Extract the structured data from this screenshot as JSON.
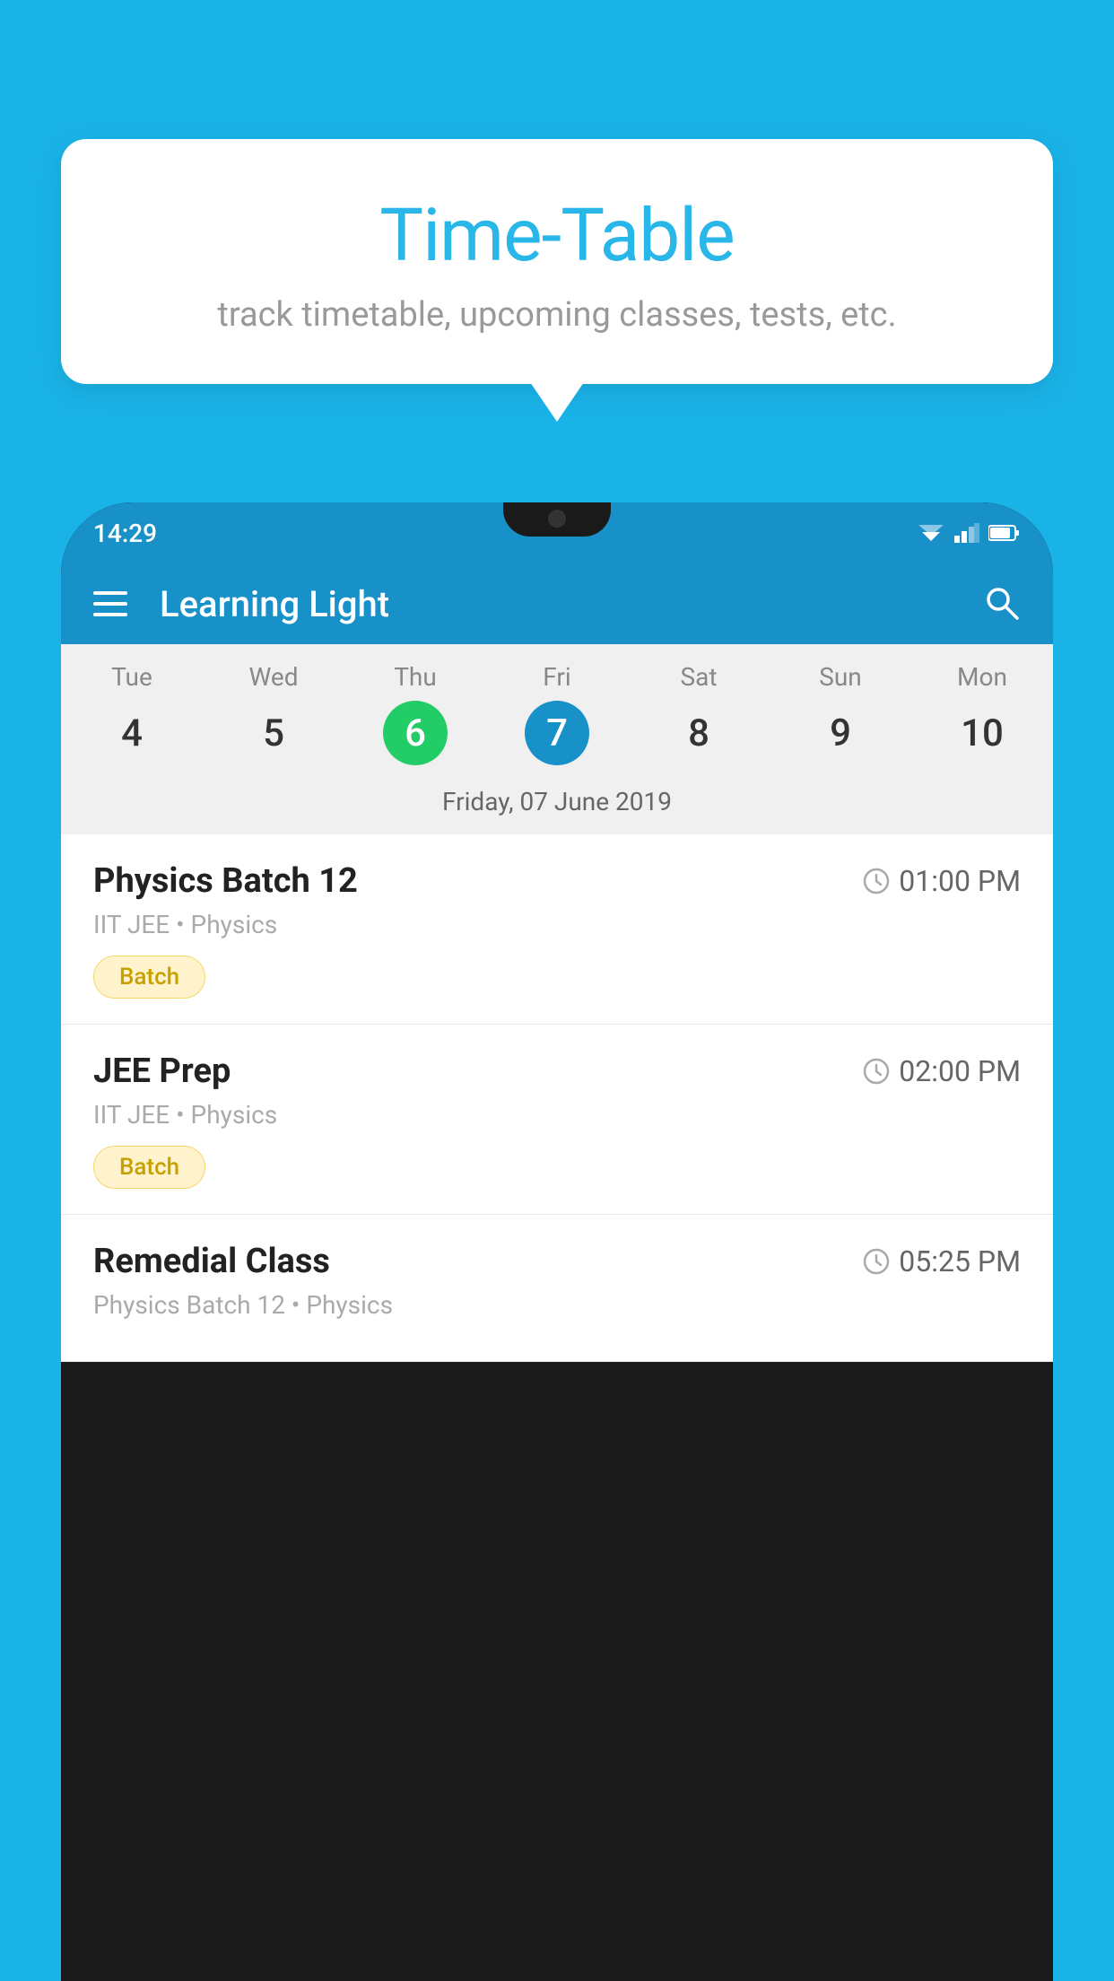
{
  "background_color": "#1ab3e8",
  "tooltip": {
    "title": "Time-Table",
    "subtitle": "track timetable, upcoming classes, tests, etc."
  },
  "phone": {
    "status_bar": {
      "time": "14:29"
    },
    "app_bar": {
      "title": "Learning Light"
    },
    "calendar": {
      "days": [
        {
          "name": "Tue",
          "num": "4",
          "state": "normal"
        },
        {
          "name": "Wed",
          "num": "5",
          "state": "normal"
        },
        {
          "name": "Thu",
          "num": "6",
          "state": "today"
        },
        {
          "name": "Fri",
          "num": "7",
          "state": "selected"
        },
        {
          "name": "Sat",
          "num": "8",
          "state": "normal"
        },
        {
          "name": "Sun",
          "num": "9",
          "state": "normal"
        },
        {
          "name": "Mon",
          "num": "10",
          "state": "normal"
        }
      ],
      "selected_date_label": "Friday, 07 June 2019"
    },
    "schedule": [
      {
        "title": "Physics Batch 12",
        "time": "01:00 PM",
        "meta": "IIT JEE • Physics",
        "badge": "Batch"
      },
      {
        "title": "JEE Prep",
        "time": "02:00 PM",
        "meta": "IIT JEE • Physics",
        "badge": "Batch"
      },
      {
        "title": "Remedial Class",
        "time": "05:25 PM",
        "meta": "Physics Batch 12 • Physics",
        "badge": null
      }
    ]
  }
}
